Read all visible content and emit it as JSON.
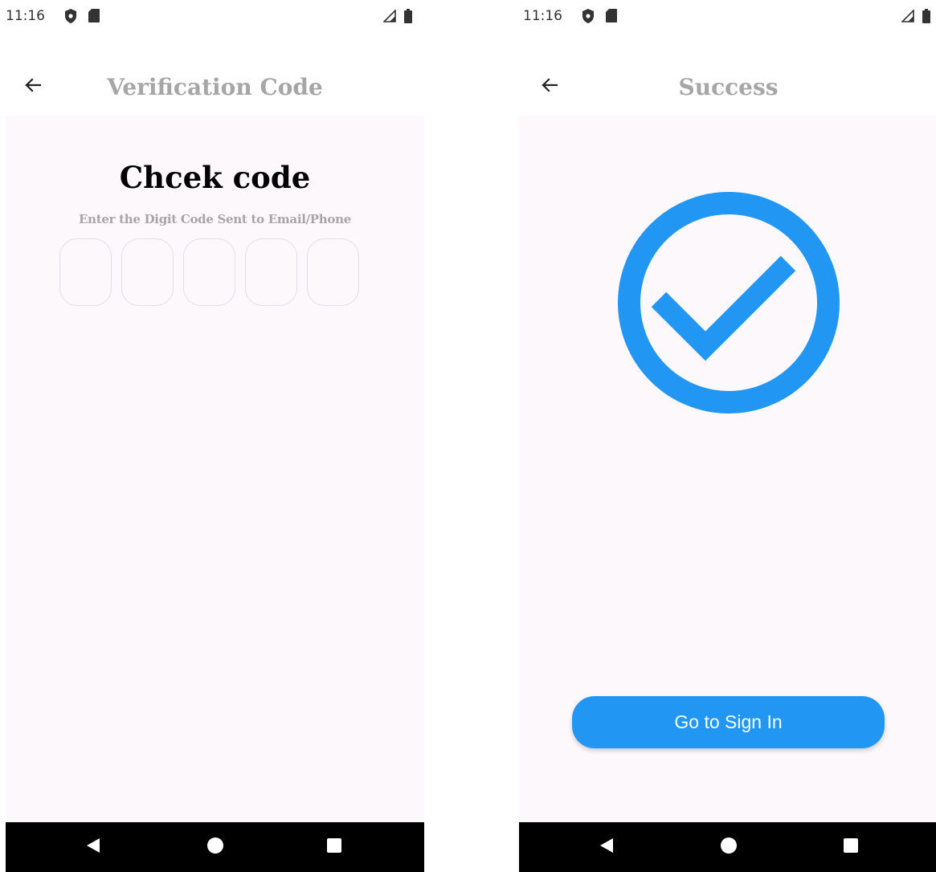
{
  "colors": {
    "accent": "#2196f3",
    "title_gray": "#a6a6a6",
    "body_bg": "#fcf8fc",
    "code_box_border": "#e4dfe6",
    "nav_bar": "#000000"
  },
  "status_bar": {
    "time": "11:16",
    "icons": [
      "shield-icon",
      "sd-card-icon",
      "signal-icon",
      "battery-icon"
    ]
  },
  "verification_screen": {
    "app_bar": {
      "back_icon": "arrow-back-icon",
      "title": "Verification Code"
    },
    "heading": "Chcek code",
    "subheading": "Enter the Digit Code Sent to Email/Phone",
    "code_fields": [
      {
        "value": ""
      },
      {
        "value": ""
      },
      {
        "value": ""
      },
      {
        "value": ""
      },
      {
        "value": ""
      }
    ]
  },
  "success_screen": {
    "app_bar": {
      "back_icon": "arrow-back-icon",
      "title": "Success"
    },
    "icon": "check-circle-icon",
    "button_label": "Go to Sign In"
  },
  "nav_bar": {
    "buttons": [
      "nav-back-icon",
      "nav-home-icon",
      "nav-recents-icon"
    ]
  }
}
